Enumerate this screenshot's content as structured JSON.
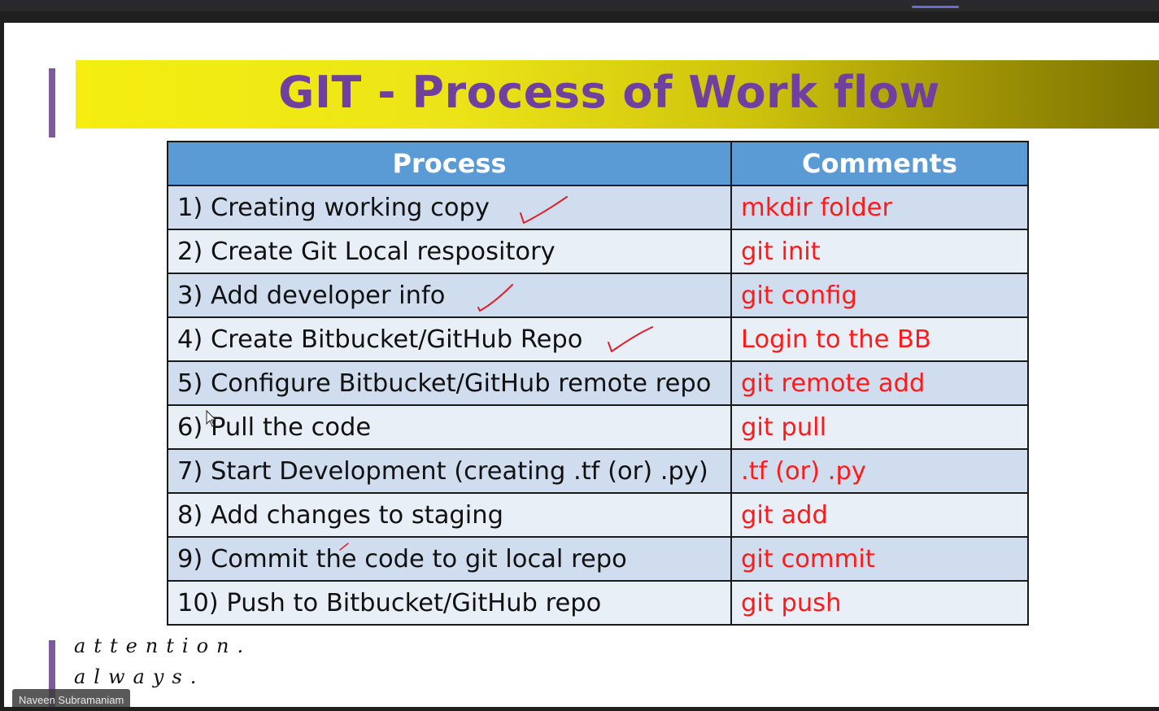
{
  "slide": {
    "title": "GIT - Process of Work flow",
    "table": {
      "headers": [
        "Process",
        "Comments"
      ],
      "rows": [
        {
          "process": "1) Creating working copy",
          "comment": "mkdir folder"
        },
        {
          "process": "2) Create Git Local respository",
          "comment": "git init"
        },
        {
          "process": "3) Add developer info",
          "comment": "git config"
        },
        {
          "process": "4) Create Bitbucket/GitHub Repo",
          "comment": "Login to the BB"
        },
        {
          "process": "5) Configure Bitbucket/GitHub remote repo",
          "comment": "git remote add"
        },
        {
          "process": "6) Pull the code",
          "comment": "git pull"
        },
        {
          "process": "7) Start Development (creating .tf (or) .py)",
          "comment": ".tf (or) .py"
        },
        {
          "process": "8) Add changes to staging",
          "comment": "git add"
        },
        {
          "process": "9) Commit the code to git local repo",
          "comment": "git commit"
        },
        {
          "process": "10) Push to Bitbucket/GitHub repo",
          "comment": "git push"
        }
      ]
    },
    "quote": {
      "line1": "attention.",
      "line2": "always."
    }
  },
  "participant": {
    "name": "Naveen Subramaniam"
  },
  "colors": {
    "title_text": "#7040a0",
    "header_bg": "#5b9bd5",
    "comment_text": "#ff1a1a",
    "annotation_ink": "#e0202a"
  }
}
